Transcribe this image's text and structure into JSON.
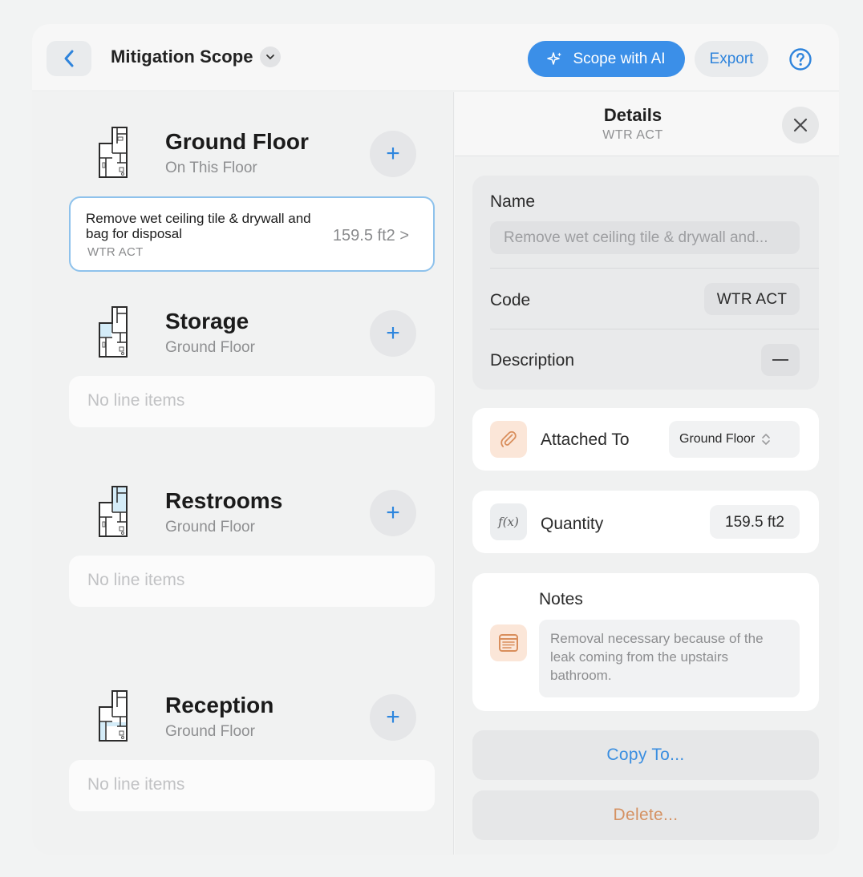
{
  "header": {
    "title": "Mitigation Scope",
    "ai_button": "Scope with AI",
    "export_button": "Export",
    "accent_color": "#3b8fe8"
  },
  "rooms": [
    {
      "name": "Ground Floor",
      "sub": "On This Floor"
    },
    {
      "name": "Storage",
      "sub": "Ground Floor"
    },
    {
      "name": "Restrooms",
      "sub": "Ground Floor"
    },
    {
      "name": "Reception",
      "sub": "Ground Floor"
    }
  ],
  "line_item": {
    "description": "Remove wet ceiling tile & drywall and bag for disposal",
    "code": "WTR ACT",
    "quantity": "159.5 ft2 >"
  },
  "empty_text": "No line items",
  "details": {
    "title": "Details",
    "subtitle": "WTR ACT",
    "name_label": "Name",
    "name_value": "Remove wet ceiling tile & drywall and...",
    "code_label": "Code",
    "code_value": "WTR ACT",
    "description_label": "Description",
    "attached_label": "Attached To",
    "attached_value": "Ground Floor",
    "quantity_label": "Quantity",
    "quantity_value": "159.5 ft2",
    "formula_icon_text": "f(x)",
    "notes_label": "Notes",
    "notes_value": "Removal necessary because of the leak coming from the upstairs bathroom.",
    "copy_button": "Copy To...",
    "delete_button": "Delete...",
    "copy_color": "#3a8ee0",
    "delete_color": "#d59263"
  }
}
